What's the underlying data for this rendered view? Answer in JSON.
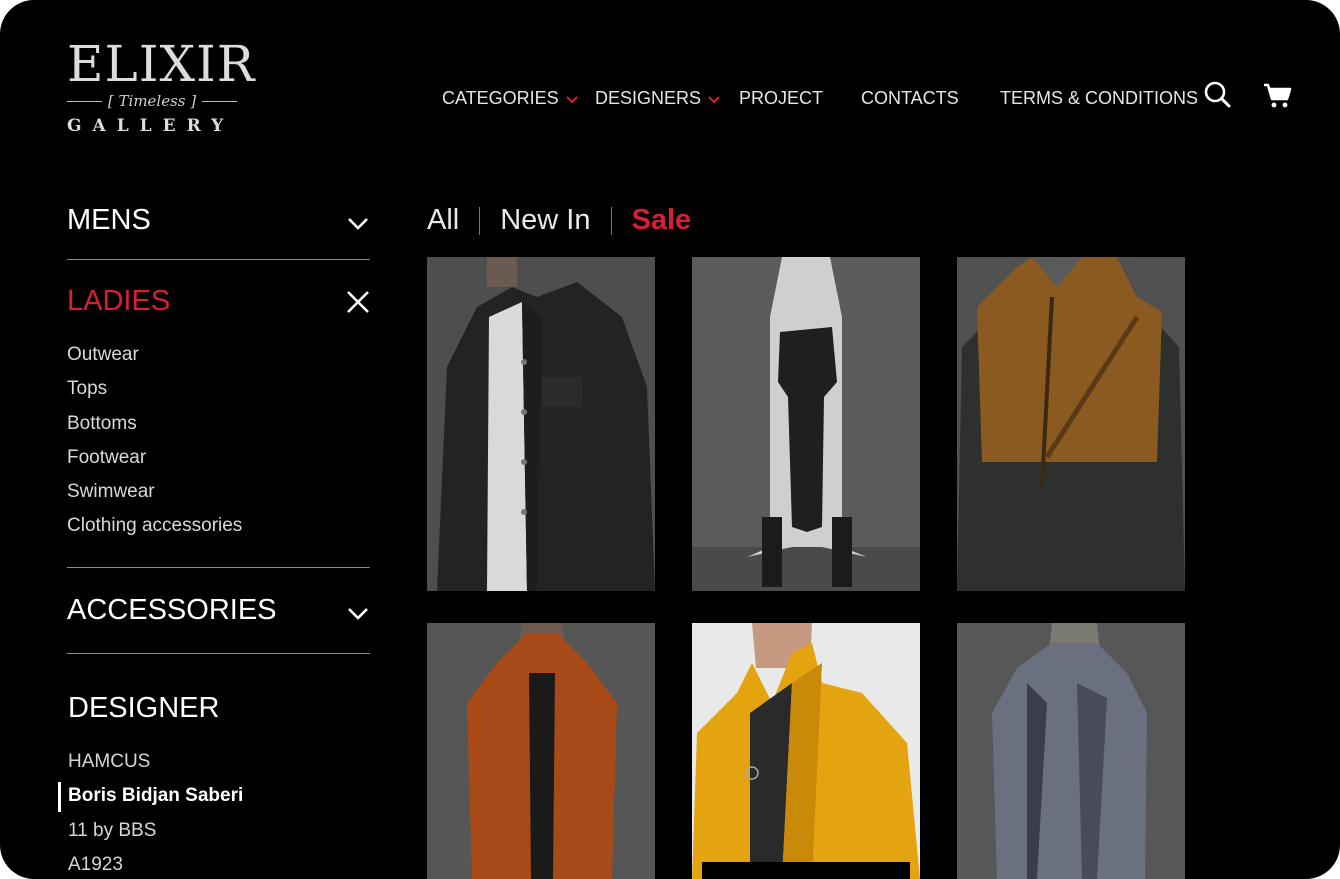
{
  "logo": {
    "main": "ELIXIR",
    "tagline": "Timeless",
    "sub": "GALLERY"
  },
  "nav": {
    "items": [
      {
        "label": "CATEGORIES",
        "dropdown": true
      },
      {
        "label": "DESIGNERS",
        "dropdown": true
      },
      {
        "label": "PROJECT",
        "dropdown": false
      },
      {
        "label": "CONTACTS",
        "dropdown": false
      },
      {
        "label": "TERMS & CONDITIONS",
        "dropdown": false
      }
    ],
    "icons": [
      "search-icon",
      "cart-icon"
    ]
  },
  "sidebar": {
    "mens": {
      "label": "MENS",
      "icon": "chevron-down-icon"
    },
    "ladies": {
      "label": "LADIES",
      "icon": "close-icon",
      "items": [
        "Outwear",
        "Tops",
        "Bottoms",
        "Footwear",
        "Swimwear",
        "Clothing accessories"
      ]
    },
    "accessories": {
      "label": "ACCESSORIES",
      "icon": "chevron-down-icon"
    },
    "designer": {
      "label": "DESIGNER",
      "items": [
        "HAMCUS",
        "Boris Bidjan Saberi",
        "11 by BBS",
        "A1923"
      ],
      "selected": "Boris Bidjan Saberi"
    }
  },
  "filters": {
    "all": "All",
    "new_in": "New In",
    "sale": "Sale",
    "active": "Sale"
  },
  "colors": {
    "background": "#000000",
    "accent": "#d61f33",
    "text": "#ffffff"
  },
  "products": [
    {
      "name": "black-denim-jacket"
    },
    {
      "name": "white-fist-print-coat"
    },
    {
      "name": "orange-vest-knit-jacket"
    },
    {
      "name": "orange-long-coat"
    },
    {
      "name": "yellow-leather-jacket"
    },
    {
      "name": "grey-dyed-long-coat"
    }
  ]
}
